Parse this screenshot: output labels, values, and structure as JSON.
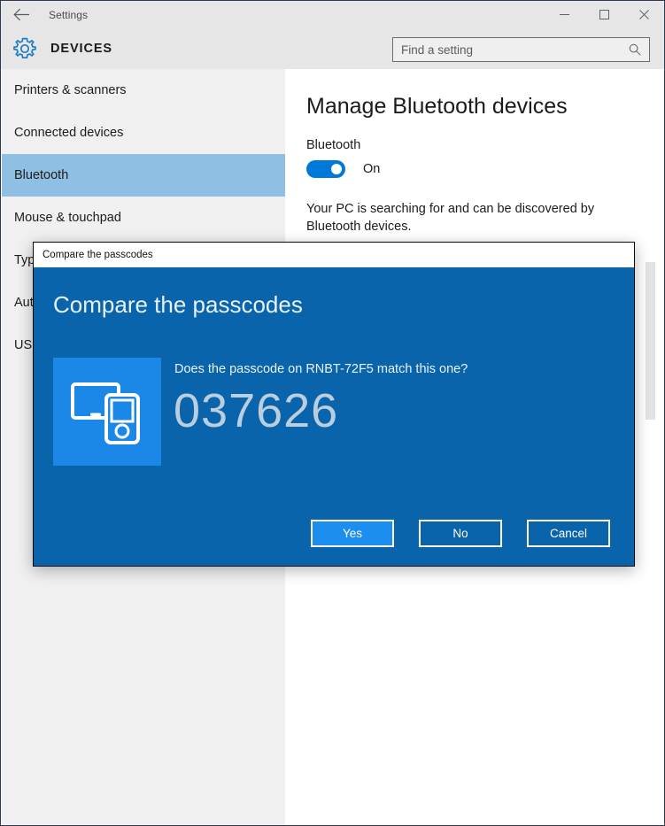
{
  "window": {
    "title": "Settings",
    "back_icon": "back-arrow-icon",
    "minimize_label": "—",
    "maximize_label": "□",
    "close_label": "✕"
  },
  "header": {
    "gear_icon": "gear-icon",
    "category": "DEVICES"
  },
  "search": {
    "placeholder": "Find a setting",
    "value": "",
    "icon": "search-icon"
  },
  "sidebar": {
    "items": [
      {
        "label": "Printers & scanners",
        "selected": false
      },
      {
        "label": "Connected devices",
        "selected": false
      },
      {
        "label": "Bluetooth",
        "selected": true
      },
      {
        "label": "Mouse & touchpad",
        "selected": false
      },
      {
        "label": "Typing",
        "selected": false
      },
      {
        "label": "AutoPlay",
        "selected": false
      },
      {
        "label": "USB",
        "selected": false
      }
    ]
  },
  "main": {
    "title": "Manage Bluetooth devices",
    "section_label": "Bluetooth",
    "toggle_state": "On",
    "toggle_on": true,
    "description": "Your PC is searching for and can be discovered by Bluetooth devices."
  },
  "dialog": {
    "titlebar": "Compare the passcodes",
    "heading": "Compare the passcodes",
    "device_icon": "laptop-and-phone-icon",
    "question": "Does the passcode on RNBT-72F5 match this one?",
    "device_name": "RNBT-72F5",
    "passcode": "037626",
    "buttons": {
      "yes": "Yes",
      "no": "No",
      "cancel": "Cancel"
    }
  },
  "colors": {
    "accent": "#0078d7",
    "dialog_bg": "#0a64ac",
    "selection": "#8fc0e3",
    "icon_tile": "#1b88e8",
    "primary_button": "#1b8ef0",
    "passcode_text": "#b9cfe0"
  }
}
